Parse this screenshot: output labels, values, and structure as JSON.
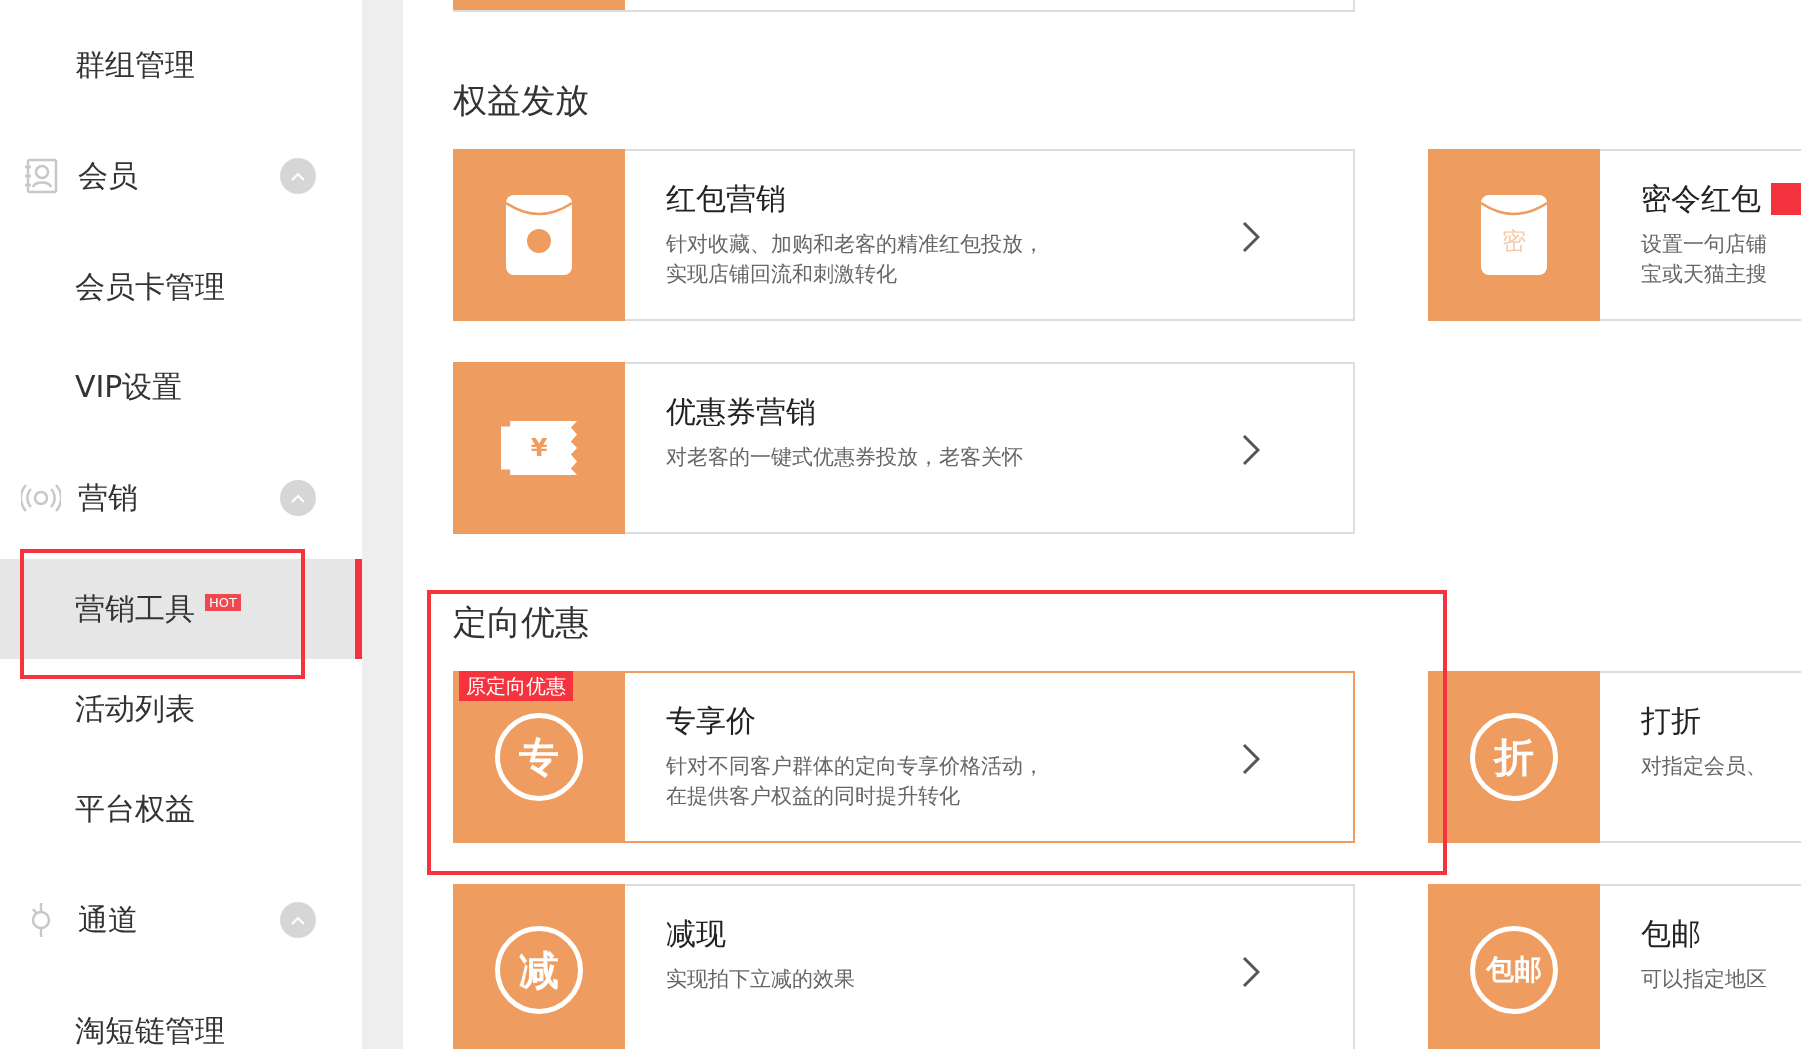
{
  "sidebar": {
    "items": [
      {
        "kind": "link",
        "label": "群组管理",
        "selected": false
      },
      {
        "kind": "group",
        "label": "会员",
        "expanded": true,
        "children": [
          {
            "label": "会员卡管理",
            "selected": false
          },
          {
            "label": "VIP设置",
            "selected": false
          }
        ]
      },
      {
        "kind": "group",
        "label": "营销",
        "expanded": true,
        "children": [
          {
            "label": "营销工具",
            "selected": true,
            "badge": "HOT",
            "annotated": true
          },
          {
            "label": "活动列表",
            "selected": false
          },
          {
            "label": "平台权益",
            "selected": false
          }
        ]
      },
      {
        "kind": "group",
        "label": "通道",
        "expanded": true,
        "children": [
          {
            "label": "淘短链管理",
            "selected": false
          }
        ]
      }
    ]
  },
  "sections": [
    {
      "title": "权益发放",
      "rows": [
        [
          {
            "title": "红包营销",
            "kind": "envelope",
            "description": [
              "针对收藏、加购和老客的精准红包投放，",
              "实现店铺回流和刺激转化"
            ],
            "highlighted": false
          },
          {
            "title": "密令红包",
            "kind": "envelope",
            "icon_text": "密",
            "title_badge": true,
            "description": [
              "设置一句店铺",
              "宝或天猫主搜"
            ],
            "highlighted": false
          }
        ],
        [
          {
            "title": "优惠券营销",
            "kind": "ticket",
            "icon_text": "¥",
            "description": [
              "对老客的一键式优惠券投放，老客关怀"
            ],
            "highlighted": false
          }
        ]
      ]
    },
    {
      "title": "定向优惠",
      "annotated": true,
      "rows": [
        [
          {
            "title": "专享价",
            "kind": "circle",
            "icon_text": "专",
            "tag": "原定向优惠",
            "description": [
              "针对不同客户群体的定向专享价格活动，",
              "在提供客户权益的同时提升转化"
            ],
            "highlighted": true
          },
          {
            "title": "打折",
            "kind": "circle",
            "icon_text": "折",
            "description": [
              "对指定会员、"
            ],
            "highlighted": false
          }
        ],
        [
          {
            "title": "减现",
            "kind": "circle",
            "icon_text": "减",
            "description": [
              "实现拍下立减的效果"
            ],
            "highlighted": false
          },
          {
            "title": "包邮",
            "kind": "circle",
            "icon_text": "包邮",
            "description": [
              "可以指定地区"
            ],
            "highlighted": false
          }
        ]
      ]
    }
  ]
}
